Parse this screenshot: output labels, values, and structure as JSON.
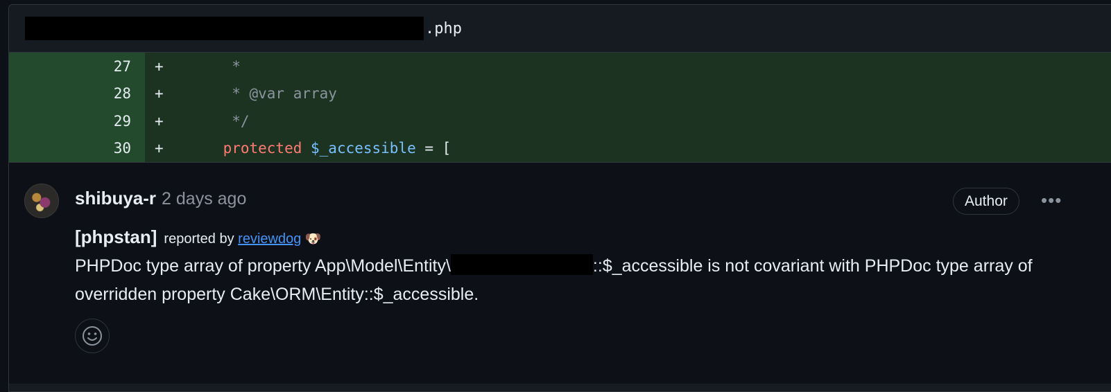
{
  "file": {
    "extension": ".php"
  },
  "diff": {
    "lines": [
      {
        "number": "27",
        "sign": "+",
        "parts": [
          {
            "cls": "c-comment",
            "text": "     *"
          }
        ]
      },
      {
        "number": "28",
        "sign": "+",
        "parts": [
          {
            "cls": "c-comment",
            "text": "     * @var array"
          }
        ]
      },
      {
        "number": "29",
        "sign": "+",
        "parts": [
          {
            "cls": "c-comment",
            "text": "     */"
          }
        ]
      },
      {
        "number": "30",
        "sign": "+",
        "parts": [
          {
            "cls": "c-kw",
            "text": "    protected "
          },
          {
            "cls": "c-var",
            "text": "$_accessible"
          },
          {
            "cls": "c-op",
            "text": " = ["
          }
        ]
      }
    ]
  },
  "comment": {
    "username": "shibuya-r",
    "time_ago": "2 days ago",
    "author_badge": "Author",
    "more_label": "•••",
    "tag": "[phpstan]",
    "reported_prefix": "reported by",
    "reporter_link": "reviewdog",
    "reporter_emoji": "🐶",
    "message_part1": "PHPDoc type array of property App\\Model\\Entity\\",
    "message_part2": "::$_accessible is not covariant with PHPDoc type array of overridden property Cake\\ORM\\Entity::$_accessible."
  },
  "icons": {
    "avatar": "avatar",
    "reaction": "smiley-icon",
    "more": "kebab-icon"
  }
}
